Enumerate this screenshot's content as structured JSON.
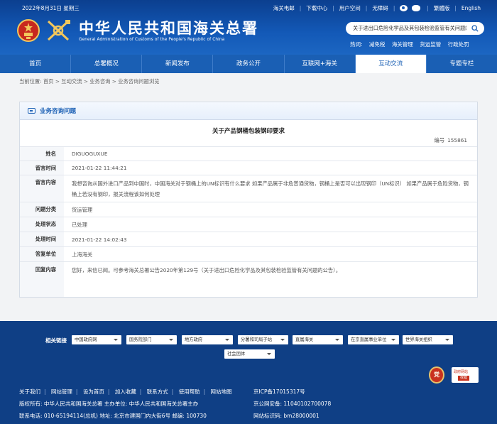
{
  "header": {
    "date": "2022年8月31日 星期三",
    "top_links": [
      "海关电邮",
      "下载中心",
      "用户空间",
      "无障碍",
      "繁體版",
      "English"
    ],
    "title_cn": "中华人民共和国海关总署",
    "title_en": "General Administration of Customs of the People's Republic of China",
    "search": {
      "value": "关于进出口危险化学品及其包装检验监管有关问题的公告"
    },
    "hot_label": "热词:",
    "hot_words": [
      "减免税",
      "海关管理",
      "货运监管",
      "行政处罚"
    ],
    "colors": {
      "primary": "#1a5fb4",
      "header_dark": "#0b3f8f",
      "footer": "#0f3f85"
    }
  },
  "nav": {
    "items": [
      "首页",
      "总署概况",
      "新闻发布",
      "政务公开",
      "互联网+海关",
      "互动交流",
      "专题专栏"
    ],
    "active_index": 5
  },
  "breadcrumb": {
    "text": "当前位置: 首页 > 互动交流 > 业务咨询 > 业务咨询问题浏览"
  },
  "panel": {
    "title": "业务咨询问题",
    "question_title": "关于产品钢桶包装钢印要求",
    "code_label": "编号",
    "code_value": "155861",
    "rows": [
      {
        "label": "姓名",
        "value": "DIGUOGUXUE"
      },
      {
        "label": "留言时间",
        "value": "2021-01-22 11:44:21"
      },
      {
        "label": "留言内容",
        "value": "我想咨询从国外进口产品到中国时，中国海关对于钢桶上的UN标识有什么要求 如果产品属于非危普通货物，钢桶上是否可以出现钢印（UN标识） 如果产品属于危险货物，钢桶上若没有钢印，报关流程该如何处理"
      },
      {
        "label": "问题分类",
        "value": "货运管理"
      },
      {
        "label": "处理状态",
        "value": "已处理"
      },
      {
        "label": "处理时间",
        "value": "2021-01-22 14:02:43"
      },
      {
        "label": "答复单位",
        "value": "上海海关"
      },
      {
        "label": "回复内容",
        "value": "您好，来信已阅。可参考海关总署公告2020年第129号（关于进出口危险化学品及其包装检验监管有关问题的公告）。"
      }
    ]
  },
  "footer": {
    "links_label": "相关链接",
    "selects": [
      "中国政府网",
      "国务院部门",
      "地方政府",
      "分署和司局子站",
      "直属海关",
      "在京直属事业单位",
      "世界海关组织",
      "社会团体"
    ],
    "bottom_links": [
      "关于我们",
      "网站管理",
      "设为首页",
      "加入收藏",
      "联系方式",
      "使用帮助",
      "网站地图"
    ],
    "copyright": "版权所有: 中华人民共和国海关总署 主办单位: 中华人民共和国海关总署主办",
    "contact": "联系电话: 010-65194114(总机) 地址: 北京市建国门内大街6号 邮编: 100730",
    "icp": "京ICP备17015317号",
    "police": "京公网安备: 11040102700078",
    "site_code": "网站标识码: bm28000001",
    "badge_gov": "党",
    "badge_err_title": "政府网站",
    "badge_err_label": "找错"
  }
}
